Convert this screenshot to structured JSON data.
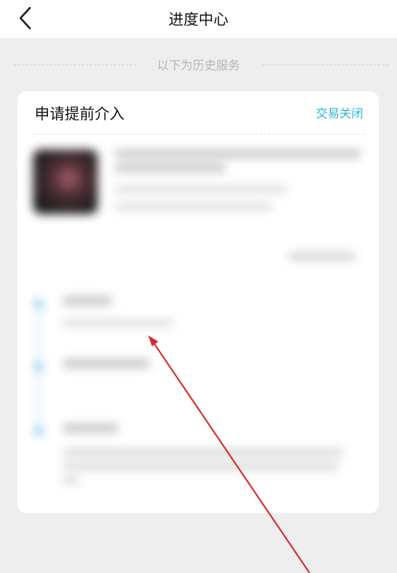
{
  "header": {
    "back_icon": "chevron-left-icon",
    "title": "进度中心"
  },
  "history_divider": {
    "label": "以下为历史服务"
  },
  "service_card": {
    "title": "申请提前介入",
    "status": "交易关闭",
    "status_color": "#2eb3d3",
    "content_blurred": true
  },
  "annotation": {
    "type": "arrow",
    "color": "#d62b2b"
  }
}
